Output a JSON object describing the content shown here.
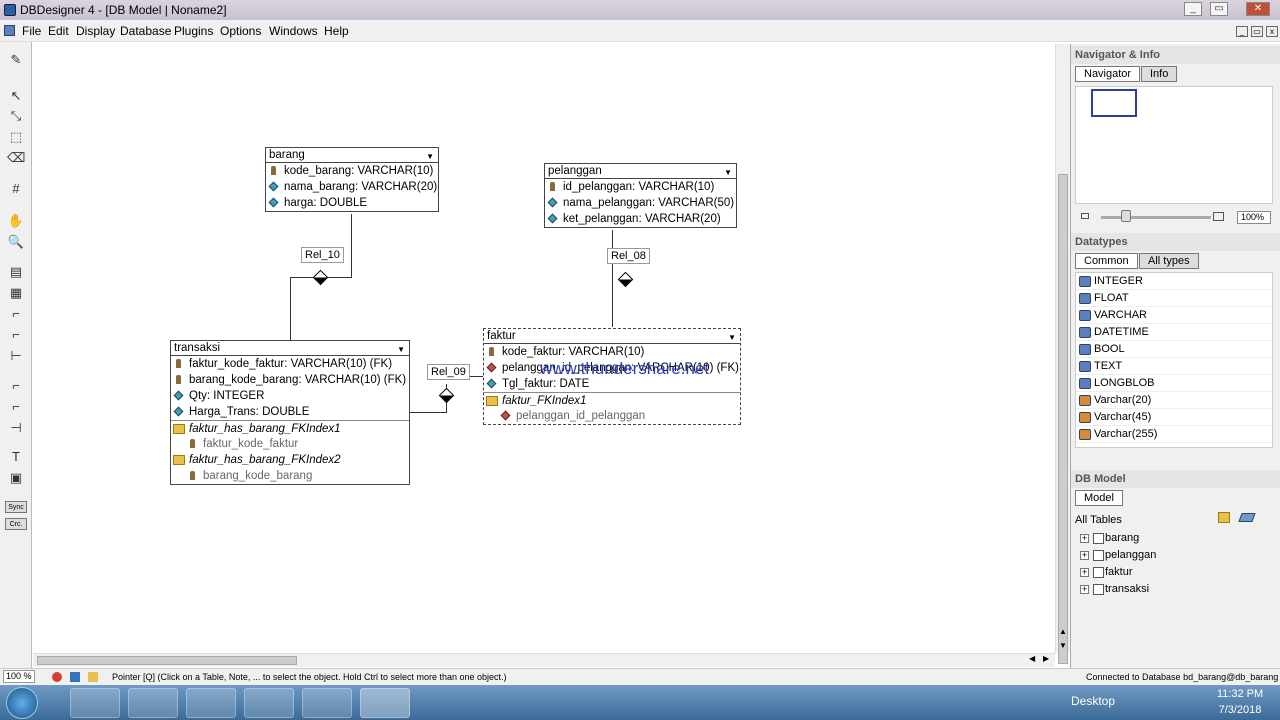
{
  "window": {
    "title": "DBDesigner 4 - [DB Model | Noname2]"
  },
  "menu": [
    "File",
    "Edit",
    "Display",
    "Database",
    "Plugins",
    "Options",
    "Windows",
    "Help"
  ],
  "toolbar": {
    "sync": "Sync",
    "crc": "Crc."
  },
  "tables": {
    "barang": {
      "name": "barang",
      "rows": [
        "kode_barang: VARCHAR(10)",
        "nama_barang: VARCHAR(20)",
        "harga: DOUBLE"
      ]
    },
    "pelanggan": {
      "name": "pelanggan",
      "rows": [
        "id_pelanggan: VARCHAR(10)",
        "nama_pelanggan: VARCHAR(50)",
        "ket_pelanggan: VARCHAR(20)"
      ]
    },
    "transaksi": {
      "name": "transaksi",
      "rows": [
        "faktur_kode_faktur: VARCHAR(10) (FK)",
        "barang_kode_barang: VARCHAR(10) (FK)",
        "Qty: INTEGER",
        "Harga_Trans: DOUBLE"
      ],
      "indexes": [
        "faktur_has_barang_FKIndex1",
        "faktur_kode_faktur",
        "faktur_has_barang_FKIndex2",
        "barang_kode_barang"
      ]
    },
    "faktur": {
      "name": "faktur",
      "rows": [
        "kode_faktur: VARCHAR(10)",
        "pelanggan_id_pelanggan: VARCHAR(10) (FK)",
        "Tgl_faktur: DATE"
      ],
      "indexes": [
        "faktur_FKIndex1",
        "pelanggan_id_pelanggan"
      ]
    }
  },
  "relations": {
    "r10": "Rel_10",
    "r08": "Rel_08",
    "r09": "Rel_09"
  },
  "watermark": "www.thundershare.net",
  "navigator": {
    "title": "Navigator & Info",
    "tabs": [
      "Navigator",
      "Info"
    ],
    "zoom": "100%"
  },
  "datatypes": {
    "title": "Datatypes",
    "tabs": [
      "Common",
      "All types"
    ],
    "items": [
      "INTEGER",
      "FLOAT",
      "VARCHAR",
      "DATETIME",
      "BOOL",
      "TEXT",
      "LONGBLOB",
      "Varchar(20)",
      "Varchar(45)",
      "Varchar(255)"
    ]
  },
  "dbmodel": {
    "title": "DB Model",
    "tab": "Model",
    "all_tables": "All Tables",
    "tables": [
      "barang",
      "pelanggan",
      "faktur",
      "transaksi"
    ]
  },
  "status": {
    "zoom": "100 %",
    "hint": "Pointer [Q] (Click on a Table, Note, ... to select the object. Hold Ctrl to select more than one object.)",
    "connection": "Connected to Database bd_barang@db_barang"
  },
  "taskbar": {
    "desktop": "Desktop",
    "time": "11:32 PM",
    "date": "7/3/2018"
  }
}
